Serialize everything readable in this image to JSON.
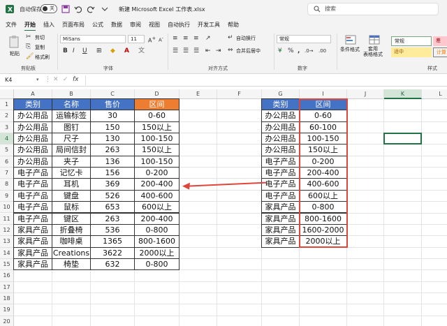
{
  "titlebar": {
    "autosave_label": "自动保存",
    "autosave_state": "关",
    "doc_title": "新建 Microsoft Excel 工作表.xlsx",
    "search_placeholder": "搜索"
  },
  "menu": [
    "文件",
    "开始",
    "插入",
    "页面布局",
    "公式",
    "数据",
    "审阅",
    "视图",
    "自动执行",
    "开发工具",
    "帮助"
  ],
  "ribbon": {
    "clipboard": {
      "paste": "粘贴",
      "cut": "剪切",
      "copy": "复制",
      "format_painter": "格式刷",
      "group": "剪贴板"
    },
    "font": {
      "name": "MiSans",
      "size": "11",
      "group": "字体",
      "bold": "B",
      "italic": "I",
      "underline": "U"
    },
    "alignment": {
      "wrap": "自动换行",
      "merge": "合并后居中",
      "group": "对齐方式"
    },
    "number": {
      "format": "常规",
      "group": "数字",
      "percent": "%",
      "comma": ","
    },
    "styles": {
      "conditional": "条件格式",
      "table": "套用\n表格格式",
      "normal": "常规",
      "neutral": "适中",
      "bad": "差",
      "calc": "计算",
      "group": "样式"
    }
  },
  "formula_bar": {
    "name_box": "K4",
    "fx": "fx"
  },
  "columns": [
    "A",
    "B",
    "C",
    "D",
    "E",
    "F",
    "G",
    "I",
    "J",
    "K",
    "L"
  ],
  "selected_column": "K",
  "rows": [
    "1",
    "2",
    "3",
    "4",
    "5",
    "6",
    "7",
    "8",
    "9",
    "10",
    "11",
    "12",
    "13",
    "14",
    "15",
    "16",
    "17",
    "18",
    "19",
    "20"
  ],
  "selected_row": "4",
  "left_table": {
    "headers": [
      "类别",
      "名称",
      "售价",
      "区间"
    ],
    "rows": [
      [
        "办公用品",
        "运输标签",
        "30",
        "0-60"
      ],
      [
        "办公用品",
        "图钉",
        "150",
        "150以上"
      ],
      [
        "办公用品",
        "尺子",
        "130",
        "100-150"
      ],
      [
        "办公用品",
        "局间信封",
        "263",
        "150以上"
      ],
      [
        "办公用品",
        "夹子",
        "136",
        "100-150"
      ],
      [
        "电子产品",
        "记忆卡",
        "156",
        "0-200"
      ],
      [
        "电子产品",
        "耳机",
        "369",
        "200-400"
      ],
      [
        "电子产品",
        "键盘",
        "526",
        "400-600"
      ],
      [
        "电子产品",
        "鼠标",
        "653",
        "600以上"
      ],
      [
        "电子产品",
        "键区",
        "263",
        "200-400"
      ],
      [
        "家具产品",
        "折叠椅",
        "536",
        "0-800"
      ],
      [
        "家具产品",
        "咖啡桌",
        "1365",
        "800-1600"
      ],
      [
        "家具产品",
        "Creations",
        "3622",
        "2000以上"
      ],
      [
        "家具产品",
        "椅垫",
        "632",
        "0-800"
      ]
    ]
  },
  "right_table": {
    "headers": [
      "类别",
      "区间"
    ],
    "rows": [
      [
        "办公用品",
        "0-60"
      ],
      [
        "办公用品",
        "60-100"
      ],
      [
        "办公用品",
        "100-150"
      ],
      [
        "办公用品",
        "150以上"
      ],
      [
        "电子产品",
        "0-200"
      ],
      [
        "电子产品",
        "200-400"
      ],
      [
        "电子产品",
        "400-600"
      ],
      [
        "电子产品",
        "600以上"
      ],
      [
        "家具产品",
        "0-800"
      ],
      [
        "家具产品",
        "800-1600"
      ],
      [
        "家具产品",
        "1600-2000"
      ],
      [
        "家具产品",
        "2000以上"
      ]
    ]
  },
  "colors": {
    "accent": "#217346",
    "header_blue": "#4472c4",
    "header_orange": "#ed7d31",
    "highlight_red": "#e0453a"
  }
}
